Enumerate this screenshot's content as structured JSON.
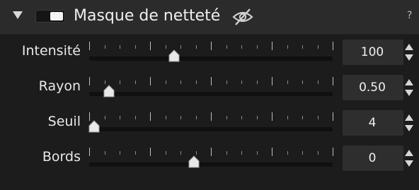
{
  "header": {
    "title": "Masque de netteté",
    "help": "?",
    "collapse_icon": "triangle-down-icon",
    "visibility_icon": "eye-slash-icon",
    "toggle_state": "on"
  },
  "rows": [
    {
      "label": "Intensité",
      "value": "100",
      "slider_fraction": 0.35
    },
    {
      "label": "Rayon",
      "value": "0.50",
      "slider_fraction": 0.08
    },
    {
      "label": "Seuil",
      "value": "4",
      "slider_fraction": 0.02
    },
    {
      "label": "Bords",
      "value": "0",
      "slider_fraction": 0.43
    }
  ],
  "colors": {
    "background": "#1c1c1c",
    "header": "#2b2b2b",
    "value_box": "#2e2e2e",
    "text": "#e9e9e9"
  }
}
